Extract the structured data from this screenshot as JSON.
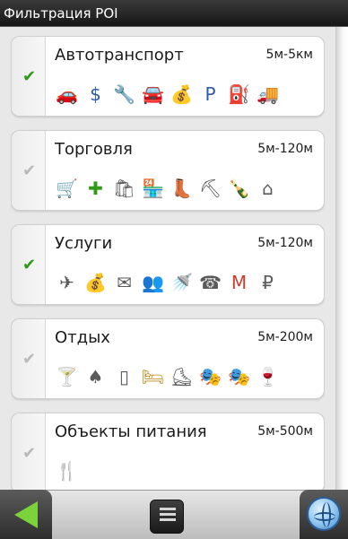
{
  "title": "Фильтрация POI",
  "colors": {
    "check_on": "#2e9a16",
    "check_off": "#b9b9b9",
    "icon_blue": "#2c5aa8",
    "back_arrow": "#7bd23a"
  },
  "categories": [
    {
      "name": "Автотранспорт",
      "range": "5м-5км",
      "checked": true,
      "icons": [
        {
          "name": "car-icon",
          "glyph": "🚗",
          "color": "#2c5aa8"
        },
        {
          "name": "car-dealer-icon",
          "glyph": "$",
          "color": "#2c5aa8"
        },
        {
          "name": "wrench-icon",
          "glyph": "🔧",
          "color": "#c0392b"
        },
        {
          "name": "car-wash-icon",
          "glyph": "🚘",
          "color": "#2c5aa8"
        },
        {
          "name": "car-sale-icon",
          "glyph": "💰",
          "color": "#a0741a"
        },
        {
          "name": "parking-icon",
          "glyph": "P",
          "color": "#2c5aa8"
        },
        {
          "name": "fuel-station-icon",
          "glyph": "⛽",
          "color": "#c8a21c"
        },
        {
          "name": "tow-truck-icon",
          "glyph": "🚚",
          "color": "#c0392b"
        }
      ]
    },
    {
      "name": "Торговля",
      "range": "5м-120м",
      "checked": false,
      "icons": [
        {
          "name": "shopping-cart-icon",
          "glyph": "🛒",
          "color": "#5a5a5a"
        },
        {
          "name": "pharmacy-icon",
          "glyph": "✚",
          "color": "#2e9a16"
        },
        {
          "name": "shop-icon",
          "glyph": "🛍",
          "color": "#5a5a5a"
        },
        {
          "name": "market-icon",
          "glyph": "🏪",
          "color": "#5a5a5a"
        },
        {
          "name": "shoe-store-icon",
          "glyph": "👢",
          "color": "#5a5a5a"
        },
        {
          "name": "garden-tools-icon",
          "glyph": "⛏",
          "color": "#5a5a5a"
        },
        {
          "name": "liquor-store-icon",
          "glyph": "🍾",
          "color": "#5a5a5a"
        },
        {
          "name": "clothing-iron-icon",
          "glyph": "⌂",
          "color": "#5a5a5a"
        }
      ]
    },
    {
      "name": "Услуги",
      "range": "5м-120м",
      "checked": true,
      "icons": [
        {
          "name": "airplane-icon",
          "glyph": "✈",
          "color": "#5a5a5a"
        },
        {
          "name": "bank-bag-icon",
          "glyph": "💰",
          "color": "#5a5a5a"
        },
        {
          "name": "post-office-icon",
          "glyph": "✉",
          "color": "#5a5a5a"
        },
        {
          "name": "people-icon",
          "glyph": "👥",
          "color": "#5a5a5a"
        },
        {
          "name": "shower-icon",
          "glyph": "🚿",
          "color": "#5a5a5a"
        },
        {
          "name": "payphone-icon",
          "glyph": "☎",
          "color": "#5a5a5a"
        },
        {
          "name": "metro-icon",
          "glyph": "M",
          "color": "#d23a2a"
        },
        {
          "name": "exchange-icon",
          "glyph": "₽",
          "color": "#5a5a5a"
        }
      ]
    },
    {
      "name": "Отдых",
      "range": "5м-200м",
      "checked": false,
      "icons": [
        {
          "name": "cocktail-bar-icon",
          "glyph": "🍸",
          "color": "#5a5a5a"
        },
        {
          "name": "casino-card-icon",
          "glyph": "♠",
          "color": "#5a5a5a"
        },
        {
          "name": "door-icon",
          "glyph": "▯",
          "color": "#5a5a5a"
        },
        {
          "name": "hotel-bed-icon",
          "glyph": "🛏",
          "color": "#c08a1a"
        },
        {
          "name": "ice-skating-icon",
          "glyph": "⛸",
          "color": "#5a5a5a"
        },
        {
          "name": "theatre-mask-icon",
          "glyph": "🎭",
          "color": "#5a5a5a"
        },
        {
          "name": "cinema-icon",
          "glyph": "🎭",
          "color": "#5a5a5a"
        },
        {
          "name": "wine-glass-icon",
          "glyph": "🍷",
          "color": "#c0392b"
        }
      ]
    },
    {
      "name": "Объекты питания",
      "range": "5м-500м",
      "checked": false,
      "icons": [
        {
          "name": "restaurant-icon",
          "glyph": "🍴",
          "color": "#5a5a5a"
        }
      ]
    }
  ]
}
